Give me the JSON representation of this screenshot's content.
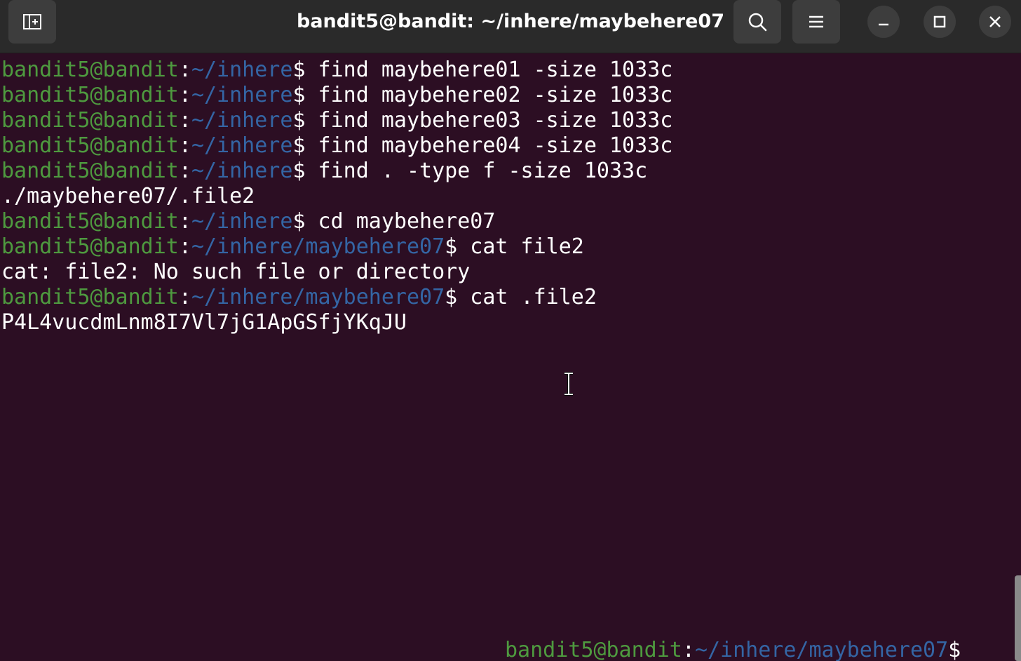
{
  "window": {
    "title": "bandit5@bandit: ~/inhere/maybehere07"
  },
  "icons": {
    "new_tab": "new-tab-icon",
    "search": "search-icon",
    "menu": "hamburger-menu-icon",
    "minimize": "minimize-icon",
    "maximize": "maximize-icon",
    "close": "close-icon",
    "cursor": "i-beam-cursor-icon"
  },
  "colors": {
    "background": "#2c0e23",
    "user": "#4e9a3f",
    "path": "#3465a4",
    "text": "#ffffff"
  },
  "terminal": {
    "lines": [
      {
        "type": "prompt",
        "user": "bandit5@bandit",
        "colon": ":",
        "path": "~/inhere",
        "dollar": "$",
        "cmd": " find maybehere01 -size 1033c"
      },
      {
        "type": "prompt",
        "user": "bandit5@bandit",
        "colon": ":",
        "path": "~/inhere",
        "dollar": "$",
        "cmd": " find maybehere02 -size 1033c"
      },
      {
        "type": "prompt",
        "user": "bandit5@bandit",
        "colon": ":",
        "path": "~/inhere",
        "dollar": "$",
        "cmd": " find maybehere03 -size 1033c"
      },
      {
        "type": "prompt",
        "user": "bandit5@bandit",
        "colon": ":",
        "path": "~/inhere",
        "dollar": "$",
        "cmd": " find maybehere04 -size 1033c"
      },
      {
        "type": "prompt",
        "user": "bandit5@bandit",
        "colon": ":",
        "path": "~/inhere",
        "dollar": "$",
        "cmd": " find . -type f -size 1033c"
      },
      {
        "type": "output",
        "text": "./maybehere07/.file2"
      },
      {
        "type": "prompt",
        "user": "bandit5@bandit",
        "colon": ":",
        "path": "~/inhere",
        "dollar": "$",
        "cmd": " cd maybehere07"
      },
      {
        "type": "prompt",
        "user": "bandit5@bandit",
        "colon": ":",
        "path": "~/inhere/maybehere07",
        "dollar": "$",
        "cmd": " cat file2"
      },
      {
        "type": "output",
        "text": "cat: file2: No such file or directory"
      },
      {
        "type": "prompt",
        "user": "bandit5@bandit",
        "colon": ":",
        "path": "~/inhere/maybehere07",
        "dollar": "$",
        "cmd": " cat .file2"
      },
      {
        "type": "output",
        "text": "P4L4vucdmLnm8I7Vl7jG1ApGSfjYKqJU"
      }
    ],
    "current_prompt": {
      "user": "bandit5@bandit",
      "colon": ":",
      "path": "~/inhere/maybehere07",
      "dollar": "$"
    }
  }
}
